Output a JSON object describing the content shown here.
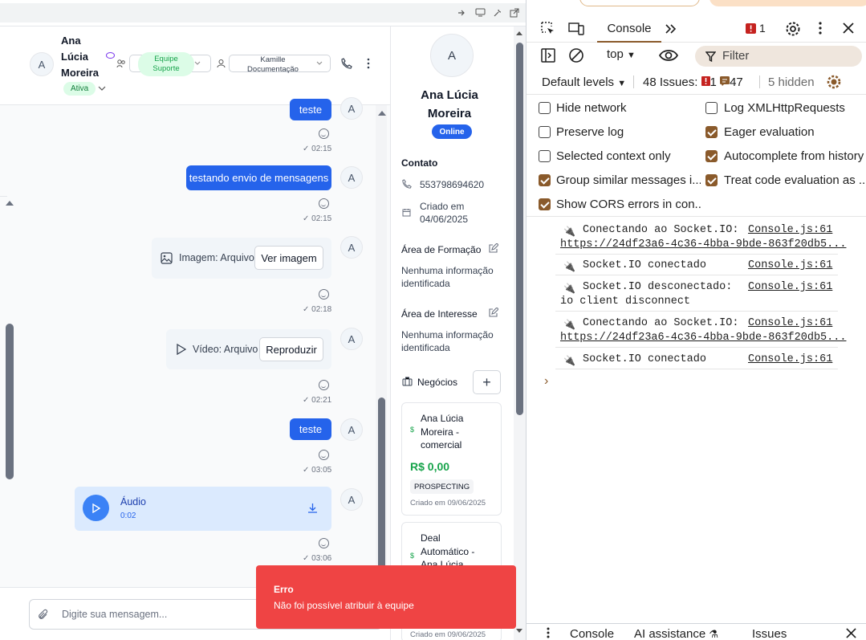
{
  "chat": {
    "contact_first": "Ana",
    "contact_second": "Lúcia",
    "contact_third": "Moreira",
    "avatar_letter": "A",
    "status_badge": "Ativa",
    "team_select_line1": "Equipe",
    "team_select_line2": "Suporte",
    "agent_select_line1": "Kamille",
    "agent_select_line2": "Documentação",
    "messages": [
      {
        "text": "teste",
        "time": "02:15"
      },
      {
        "text": "testando envio de mensagens",
        "time": "02:15"
      },
      {
        "text": "Imagem: Arquivo",
        "button": "Ver imagem",
        "time": "02:18"
      },
      {
        "text": "Vídeo: Arquivo",
        "button": "Reproduzir",
        "time": "02:21"
      },
      {
        "text": "teste",
        "time": "03:05"
      },
      {
        "title": "Áudio",
        "duration": "0:02",
        "time": "03:06"
      }
    ],
    "input_placeholder": "Digite sua mensagem..."
  },
  "profile": {
    "avatar_letter": "A",
    "name_line1": "Ana Lúcia",
    "name_line2": "Moreira",
    "online_badge": "Online",
    "contact_title": "Contato",
    "phone": "553798694620",
    "created_label": "Criado em",
    "created_date": "04/06/2025",
    "formacao_title": "Área de Formação",
    "formacao_value_1": "Nenhuma informação",
    "formacao_value_2": "identificada",
    "interesse_title": "Área de Interesse",
    "interesse_value_1": "Nenhuma informação",
    "interesse_value_2": "identificada",
    "negocios_title": "Negócios",
    "deals": [
      {
        "name_1": "Ana Lúcia",
        "name_2": "Moreira -",
        "name_3": "comercial",
        "value": "R$ 0,00",
        "stage": "PROSPECTING",
        "created": "Criado em 09/06/2025"
      },
      {
        "name_1": "Deal",
        "name_2": "Automático -",
        "name_3": "Ana Lúcia",
        "created": "Criado em 09/06/2025"
      }
    ]
  },
  "toast": {
    "title": "Erro",
    "message": "Não foi possível atribuir à equipe",
    "color": "#ef4444"
  },
  "devtools": {
    "tab_console": "Console",
    "error_count": "1",
    "context": "top",
    "filter_placeholder": "Filter",
    "default_levels": "Default levels",
    "issues_label": "48 Issues:",
    "issues_error": "1",
    "issues_info": "47",
    "hidden": "5 hidden",
    "settings": [
      {
        "label": "Hide network",
        "checked": false
      },
      {
        "label": "Log XMLHttpRequests",
        "checked": false
      },
      {
        "label": "Preserve log",
        "checked": false
      },
      {
        "label": "Eager evaluation",
        "checked": true
      },
      {
        "label": "Selected context only",
        "checked": false
      },
      {
        "label": "Autocomplete from history",
        "checked": true
      },
      {
        "label": "Group similar messages i...",
        "checked": true
      },
      {
        "label": "Treat code evaluation as ...",
        "checked": true
      },
      {
        "label": "Show CORS errors in con...",
        "checked": true
      }
    ],
    "logs": [
      {
        "text": "Conectando ao Socket.IO:",
        "source": "Console.js:61",
        "extra": "https://24df23a6-4c36-4bba-9bde-863f20db5..."
      },
      {
        "text": "Socket.IO conectado",
        "source": "Console.js:61"
      },
      {
        "text": "Socket.IO desconectado:",
        "source": "Console.js:61",
        "extra": "io client disconnect"
      },
      {
        "text": "Conectando ao Socket.IO:",
        "source": "Console.js:61",
        "extra": "https://24df23a6-4c36-4bba-9bde-863f20db5..."
      },
      {
        "text": "Socket.IO conectado",
        "source": "Console.js:61"
      }
    ],
    "drawer_tabs": [
      "Console",
      "AI assistance",
      "Issues"
    ],
    "accent_color": "#8a5a2b"
  }
}
